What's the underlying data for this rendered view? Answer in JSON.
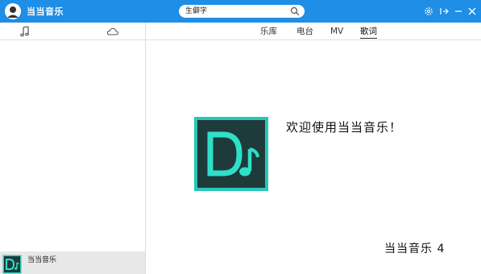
{
  "app": {
    "title": "当当音乐"
  },
  "search": {
    "value": "生僻字"
  },
  "tabs": [
    {
      "label": "乐库"
    },
    {
      "label": "电台"
    },
    {
      "label": "MV"
    },
    {
      "label": "歌词",
      "active": true
    }
  ],
  "window_controls": [
    "settings-icon",
    "mini-mode-icon",
    "minimize-icon",
    "close-icon"
  ],
  "sidebar": {
    "tabs": [
      "music-note-icon",
      "cloud-icon"
    ]
  },
  "main": {
    "welcome": "欢迎使用当当音乐！",
    "version": "当当音乐 4"
  },
  "now_playing": {
    "title": "当当音乐"
  },
  "colors": {
    "titlebar": "#1e8ee6",
    "logo_bg": "#1e3a3a",
    "logo_border": "#27c7b8",
    "logo_fg": "#2fe0c8"
  }
}
